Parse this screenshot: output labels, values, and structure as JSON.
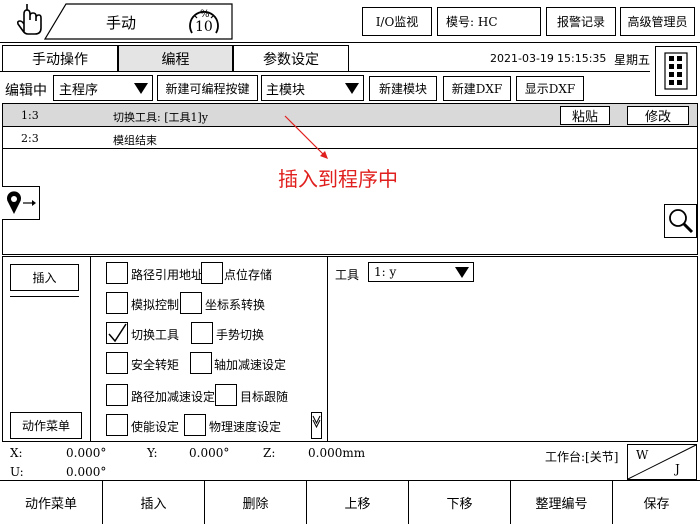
{
  "header": {
    "mode_label": "手动",
    "gauge_symbol": "%",
    "gauge_value": "10",
    "io_button": "I/O监视",
    "model_label": "模号: HC",
    "alarm_button": "报警记录",
    "user_button": "高级管理员"
  },
  "tabs": [
    {
      "label": "手动操作"
    },
    {
      "label": "编程"
    },
    {
      "label": "参数设定"
    }
  ],
  "datetime": {
    "date": "2021-03-19",
    "time": "15:15:35",
    "weekday": "星期五"
  },
  "toolbar": {
    "edit_label": "编辑中",
    "program_select": "主程序",
    "new_key_button": "新建可编程按键",
    "module_select": "主模块",
    "new_module_button": "新建模块",
    "new_dxf_button": "新建DXF",
    "show_dxf_button": "显示DXF"
  },
  "program_lines": [
    {
      "num": "1:3",
      "text": "切换工具: [工具1]y"
    },
    {
      "num": "2:3",
      "text": "模组结束"
    }
  ],
  "row_actions": {
    "paste": "粘贴",
    "modify": "修改"
  },
  "annotation": "插入到程序中",
  "left_panel": {
    "insert_button": "插入",
    "action_menu_button": "动作菜单"
  },
  "commands": [
    {
      "label": "路径引用地址",
      "checked": false
    },
    {
      "label": "点位存储",
      "checked": false
    },
    {
      "label": "模拟控制",
      "checked": false
    },
    {
      "label": "坐标系转换",
      "checked": false
    },
    {
      "label": "切换工具",
      "checked": true
    },
    {
      "label": "手势切换",
      "checked": false
    },
    {
      "label": "安全转矩",
      "checked": false
    },
    {
      "label": "轴加减速设定",
      "checked": false
    },
    {
      "label": "路径加减速设定",
      "checked": false
    },
    {
      "label": "目标跟随",
      "checked": false
    },
    {
      "label": "使能设定",
      "checked": false
    },
    {
      "label": "物理速度设定",
      "checked": false
    }
  ],
  "tool": {
    "label": "工具",
    "value": "1: y"
  },
  "status": {
    "x_label": "X:",
    "x_value": "0.000°",
    "y_label": "Y:",
    "y_value": "0.000°",
    "z_label": "Z:",
    "z_value": "0.000mm",
    "u_label": "U:",
    "u_value": "0.000°",
    "workbench": "工作台:[关节]",
    "w_label": "W",
    "j_label": "J"
  },
  "bottom_buttons": [
    {
      "label": "动作菜单"
    },
    {
      "label": "插入"
    },
    {
      "label": "删除"
    },
    {
      "label": "上移"
    },
    {
      "label": "下移"
    },
    {
      "label": "整理编号"
    },
    {
      "label": "保存"
    }
  ],
  "colors": {
    "annotation": "#e0201e",
    "selected_row": "#d9d9d9",
    "active_tab": "#e4e4e4"
  }
}
